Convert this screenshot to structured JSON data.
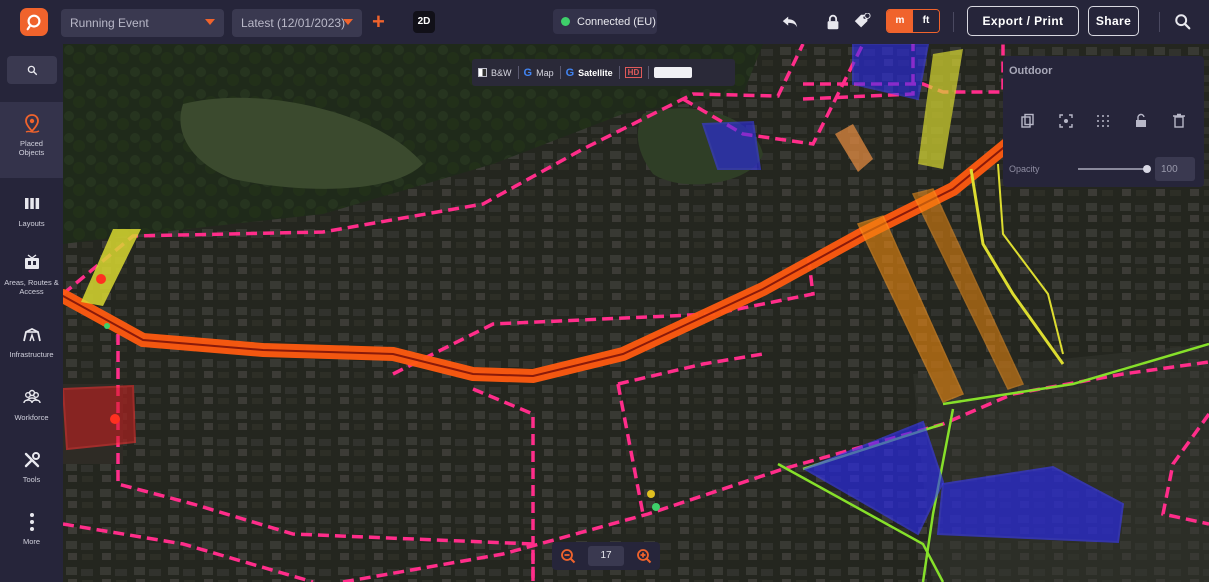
{
  "topbar": {
    "event_select": "Running Event",
    "version_select": "Latest (12/01/2023)",
    "view_mode": "2D",
    "connection": "Connected (EU)",
    "unit_m": "m",
    "unit_ft": "ft",
    "export_label": "Export / Print",
    "share_label": "Share"
  },
  "sidebar": {
    "items": [
      {
        "label": "Placed Objects",
        "icon": "map-pin-icon"
      },
      {
        "label": "Layouts",
        "icon": "columns-icon"
      },
      {
        "label": "Areas, Routes & Access",
        "icon": "areas-icon"
      },
      {
        "label": "Infrastructure",
        "icon": "tent-icon"
      },
      {
        "label": "Workforce",
        "icon": "people-icon"
      },
      {
        "label": "Tools",
        "icon": "wrench-icon"
      },
      {
        "label": "More",
        "icon": "more-icon"
      }
    ]
  },
  "basemap": {
    "bw": "B&W",
    "map": "Map",
    "satellite": "Satellite",
    "hd": "HD"
  },
  "panel": {
    "title": "Outdoor",
    "opacity_label": "Opacity",
    "opacity_value": "100"
  },
  "zoom": {
    "level": "17"
  },
  "colors": {
    "accent": "#f0632c",
    "route_pink": "#ff2d8a",
    "route_orange": "#ff6a1a",
    "zone_blue": "#2a2aff",
    "zone_yellow": "#e6e630",
    "zone_green": "#9ae62a",
    "zone_red": "#e02020"
  }
}
